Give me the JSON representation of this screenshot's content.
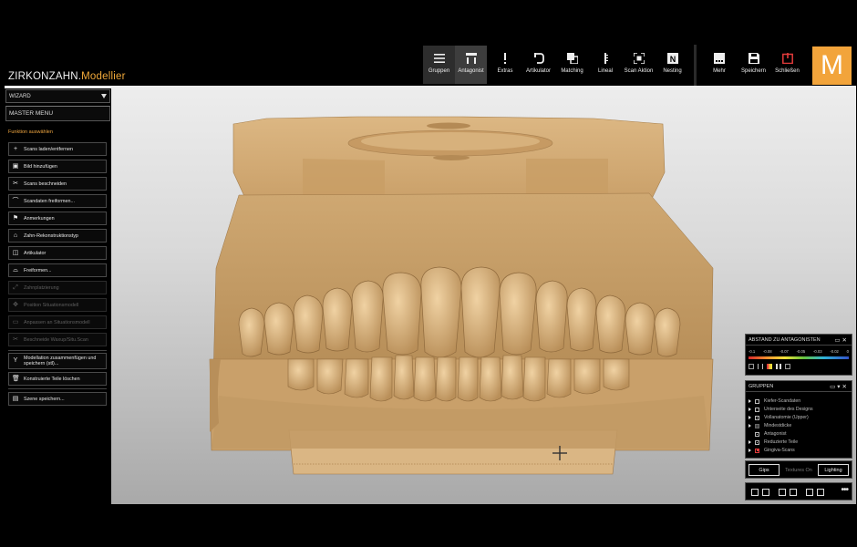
{
  "app": {
    "brand_main": "ZIRKONZAHN.",
    "brand_accent": "Modellier",
    "logo_letter": "M"
  },
  "toolbar": {
    "items": [
      {
        "label": "Gruppen",
        "icon": "hamburger-icon"
      },
      {
        "label": "Antagonist",
        "icon": "antagonist-icon"
      },
      {
        "label": "Extras",
        "icon": "exclamation-icon"
      },
      {
        "label": "Artikulator",
        "icon": "articulator-icon"
      },
      {
        "label": "Matching",
        "icon": "matching-icon"
      },
      {
        "label": "Lineal",
        "icon": "ruler-icon"
      },
      {
        "label": "Scan Aktion",
        "icon": "scan-icon"
      },
      {
        "label": "Nesting",
        "icon": "nesting-icon"
      }
    ],
    "right_items": [
      {
        "label": "Mehr",
        "icon": "more-icon"
      },
      {
        "label": "Speichern",
        "icon": "save-icon"
      },
      {
        "label": "Schließen",
        "icon": "close-icon"
      }
    ]
  },
  "left": {
    "wizard": "WIZARD",
    "master_menu": "MASTER MENU",
    "section_title": "Funktion auswählen",
    "items": [
      {
        "label": "Scans laden/entfernen",
        "icon": "+",
        "enabled": true
      },
      {
        "label": "Bild hinzufügen",
        "icon": "▣",
        "enabled": true
      },
      {
        "label": "Scans beschneiden",
        "icon": "✂",
        "enabled": true
      },
      {
        "label": "Scandaten freiformen...",
        "icon": "⌒",
        "enabled": true
      },
      {
        "label": "Anmerkungen",
        "icon": "⚑",
        "enabled": true
      },
      {
        "label": "Zahn-Rekonstruktionstyp",
        "icon": "⌂",
        "enabled": true
      },
      {
        "label": "Artikulator",
        "icon": "◫",
        "enabled": true
      },
      {
        "label": "Freiformen...",
        "icon": "⌓",
        "enabled": true
      },
      {
        "label": "Zahnplatzierung",
        "icon": "⤢",
        "enabled": false
      },
      {
        "label": "Position Situationsmodell",
        "icon": "✥",
        "enabled": false
      },
      {
        "label": "Anpassen an Situationsmodell",
        "icon": "▭",
        "enabled": false
      },
      {
        "label": "Beschneide Waxup/Situ.Scan",
        "icon": "✂",
        "enabled": false
      }
    ],
    "merge_line1": "Modellation zusammenfügen und",
    "merge_line2": "speichern (stl)...",
    "delete_label": "Konstruierte Teile löschen",
    "save_scene": "Szene speichern..."
  },
  "abstand": {
    "title": "ABSTAND ZU ANTAGONISTEN",
    "ticks": [
      "-0.1",
      "-0.08",
      "-0.07",
      "-0.05",
      "-0.03",
      "-0.02",
      "0"
    ]
  },
  "gruppen": {
    "title": "GRUPPEN",
    "items": [
      {
        "label": "Kiefer-Scandaten",
        "arrow": true,
        "state": "off"
      },
      {
        "label": "Unterseite des Designs",
        "arrow": true,
        "state": "off"
      },
      {
        "label": "Vollanatomie (Upper)",
        "arrow": true,
        "state": "on"
      },
      {
        "label": "Mindestdicke",
        "arrow": true,
        "state": "dark"
      },
      {
        "label": "Antagonist",
        "arrow": false,
        "state": "on"
      },
      {
        "label": "Reduzierte Teile",
        "arrow": true,
        "state": "on"
      },
      {
        "label": "Gingiva-Scans",
        "arrow": true,
        "state": "red"
      }
    ]
  },
  "modes": {
    "gips": "Gips",
    "textures": "Textures On",
    "lighting": "Lighting"
  },
  "colors": {
    "accent": "#f2a43b",
    "model": "#d9b27e"
  }
}
